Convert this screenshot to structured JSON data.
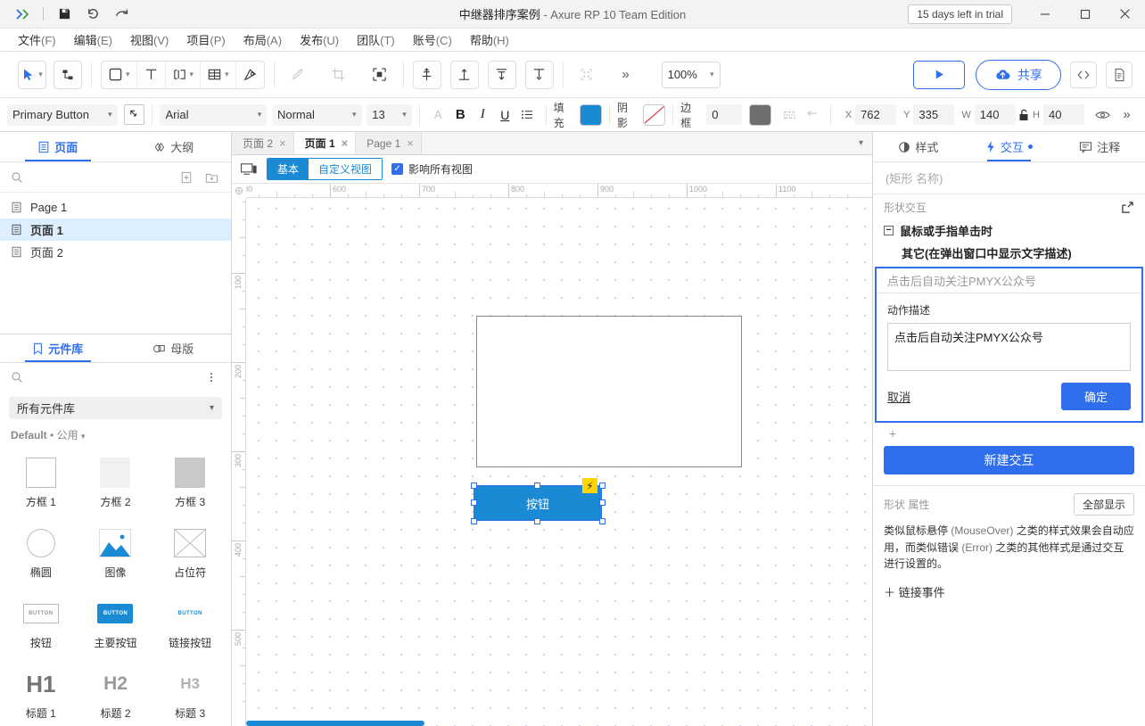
{
  "window": {
    "title_project": "中继器排序案例",
    "title_app": " - Axure RP 10 Team Edition",
    "trial_badge": "15 days left in trial",
    "logo": "axure-logo-icon",
    "save_icon": "save-icon",
    "undo_icon": "undo-icon",
    "redo_icon": "redo-icon",
    "minimize": "minimize-icon",
    "maximize": "maximize-icon",
    "close": "close-icon"
  },
  "menu": [
    {
      "label": "文件",
      "mnemonic": "(F)"
    },
    {
      "label": "编辑",
      "mnemonic": "(E)"
    },
    {
      "label": "视图",
      "mnemonic": "(V)"
    },
    {
      "label": "项目",
      "mnemonic": "(P)"
    },
    {
      "label": "布局",
      "mnemonic": "(A)"
    },
    {
      "label": "发布",
      "mnemonic": "(U)"
    },
    {
      "label": "团队",
      "mnemonic": "(T)"
    },
    {
      "label": "账号",
      "mnemonic": "(C)"
    },
    {
      "label": "帮助",
      "mnemonic": "(H)"
    }
  ],
  "toolbar": {
    "select_tool": "cursor-select-icon",
    "connector_tool": "connector-icon",
    "shape_tool": "rectangle-shape-icon",
    "text_tool": "text-tool-icon",
    "paragraph_tool": "text-field-icon",
    "table_tool": "table-icon",
    "pen_tool": "pen-icon",
    "eyedropper": "eyedropper-icon",
    "crop": "crop-icon",
    "distribute": "distribute-icon",
    "align_center": "align-center-icon",
    "align_top": "align-top-icon",
    "align_bottom_dist": "distribute-vertical-icon",
    "align_bottom": "align-bottom-icon",
    "group": "group-icon",
    "overflow": "»",
    "zoom_value": "100%",
    "preview_label": "preview-play-icon",
    "share_label": "共享",
    "share_icon": "cloud-upload-icon",
    "code_icon": "code-icon",
    "notes_icon": "document-icon"
  },
  "stylebar": {
    "widget_style": "Primary Button",
    "style_picker_icon": "style-picker-icon",
    "font_family": "Arial",
    "font_weight": "Normal",
    "font_size": "13",
    "font_color_icon": "A",
    "bold": "B",
    "italic": "I",
    "underline": "U",
    "list": "list-icon",
    "fill_label": "填充",
    "fill_color": "#1a8ad4",
    "shadow_label": "阴影",
    "shadow_icon": "no-shadow-icon",
    "border_label": "边框",
    "border_width": "0",
    "border_color": "#6e6e6e",
    "line_style_icon": "line-style-icon",
    "arrow_icon": "arrow-style-icon",
    "x_label": "X",
    "x_value": "762",
    "y_label": "Y",
    "y_value": "335",
    "w_label": "W",
    "w_value": "140",
    "lock_icon": "unlock-icon",
    "h_label": "H",
    "h_value": "40",
    "visibility_icon": "eye-icon",
    "more_icon": "»"
  },
  "left_panel": {
    "tabs": [
      {
        "label": "页面",
        "icon": "pages-icon",
        "active": true
      },
      {
        "label": "大纲",
        "icon": "outline-icon",
        "active": false
      }
    ],
    "search_icon": "search-icon",
    "add_page_icon": "add-page-icon",
    "add_folder_icon": "add-folder-icon",
    "pages": [
      {
        "label": "Page 1",
        "icon": "page-icon",
        "active": false
      },
      {
        "label": "页面 1",
        "icon": "page-icon",
        "active": true
      },
      {
        "label": "页面 2",
        "icon": "page-icon",
        "active": false
      }
    ],
    "library": {
      "tabs": [
        {
          "label": "元件库",
          "icon": "library-icon",
          "active": true
        },
        {
          "label": "母版",
          "icon": "masters-icon",
          "active": false
        }
      ],
      "search_icon": "search-icon",
      "menu_icon": "kebab-menu-icon",
      "selector": "所有元件库",
      "group_title": "Default",
      "group_sub": "公用",
      "items": [
        {
          "name": "方框 1",
          "art": "box-outline"
        },
        {
          "name": "方框 2",
          "art": "box-light"
        },
        {
          "name": "方框 3",
          "art": "box-dark"
        },
        {
          "name": "椭圆",
          "art": "ellipse"
        },
        {
          "name": "图像",
          "art": "image"
        },
        {
          "name": "占位符",
          "art": "placeholder"
        },
        {
          "name": "按钮",
          "art": "button-outline"
        },
        {
          "name": "主要按钮",
          "art": "button-primary"
        },
        {
          "name": "链接按钮",
          "art": "button-link"
        },
        {
          "name": "标题 1",
          "art": "h1"
        },
        {
          "name": "标题 2",
          "art": "h2"
        },
        {
          "name": "标题 3",
          "art": "h3"
        }
      ],
      "button_art_label": "BUTTON",
      "heading_art": [
        "H1",
        "H2",
        "H3"
      ]
    }
  },
  "canvas": {
    "doc_tabs": [
      {
        "label": "页面 2",
        "active": false
      },
      {
        "label": "页面 1",
        "active": true
      },
      {
        "label": "Page 1",
        "active": false
      }
    ],
    "tab_close_icon": "close-icon",
    "collapse_icon": "chevron-down-icon",
    "device_icon": "device-view-icon",
    "views": [
      {
        "label": "基本",
        "active": true
      },
      {
        "label": "自定义视图",
        "active": false
      }
    ],
    "affect_all_label": "影响所有视图",
    "affect_all_checked": true,
    "ruler_origin_icon": "ruler-origin-icon",
    "ruler_h_labels": [
      "00",
      "600",
      "700",
      "800",
      "900",
      "1000",
      "1100"
    ],
    "ruler_v_labels": [
      "100",
      "200",
      "300",
      "400",
      "500"
    ],
    "shapes": [
      {
        "name": "rectangle-shape",
        "label": ""
      },
      {
        "name": "selected-button",
        "label": "按钮"
      }
    ],
    "lightning_badge": "interaction-badge-icon"
  },
  "right_panel": {
    "tabs": [
      {
        "label": "样式",
        "icon": "style-icon",
        "active": false,
        "dot": false
      },
      {
        "label": "交互",
        "icon": "interaction-icon",
        "active": true,
        "dot": true
      },
      {
        "label": "注释",
        "icon": "notes-icon",
        "active": false,
        "dot": false
      }
    ],
    "name_placeholder": "(矩形 名称)",
    "section_title": "形状交互",
    "expand_icon": "open-external-icon",
    "event_name": "鼠标或手指单击时",
    "collapse_symbol": "−",
    "action_name": "其它(在弹出窗口中显示文字描述)",
    "dialog": {
      "header_text": "点击后自动关注PMYX公众号",
      "field_label": "动作描述",
      "textarea_value": "点击后自动关注PMYX公众号",
      "cancel_label": "取消",
      "ok_label": "确定"
    },
    "add_action_icon": "+",
    "new_interaction_label": "新建交互",
    "properties": {
      "title": "形状 属性",
      "show_all_label": "全部显示",
      "description_1": "类似鼠标悬停 ",
      "description_mouseover": "(MouseOver)",
      "description_2": " 之类的样式效果会自动应用，而类似错误 ",
      "description_error": "(Error)",
      "description_3": " 之类的其他样式是通过交互进行设置的。",
      "link_event_label": "＋ 链接事件"
    }
  }
}
